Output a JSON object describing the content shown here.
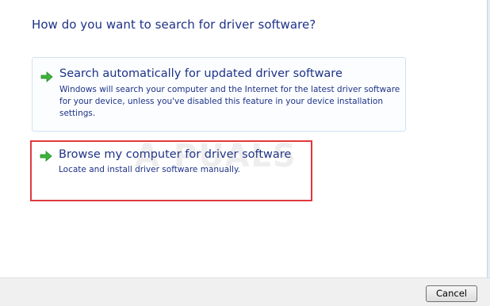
{
  "dialog": {
    "heading": "How do you want to search for driver software?",
    "options": [
      {
        "title": "Search automatically for updated driver software",
        "description": "Windows will search your computer and the Internet for the latest driver software for your device, unless you've disabled this feature in your device installation settings.",
        "icon": "green-arrow-icon"
      },
      {
        "title": "Browse my computer for driver software",
        "description": "Locate and install driver software manually.",
        "icon": "green-arrow-icon"
      }
    ],
    "watermark": "A PUALS",
    "cancel_label": "Cancel"
  },
  "colors": {
    "text_blue": "#1e3287",
    "arrow_green": "#3cb43c",
    "highlight_red": "#e0393e",
    "footer_bg": "#f0f0f0"
  }
}
